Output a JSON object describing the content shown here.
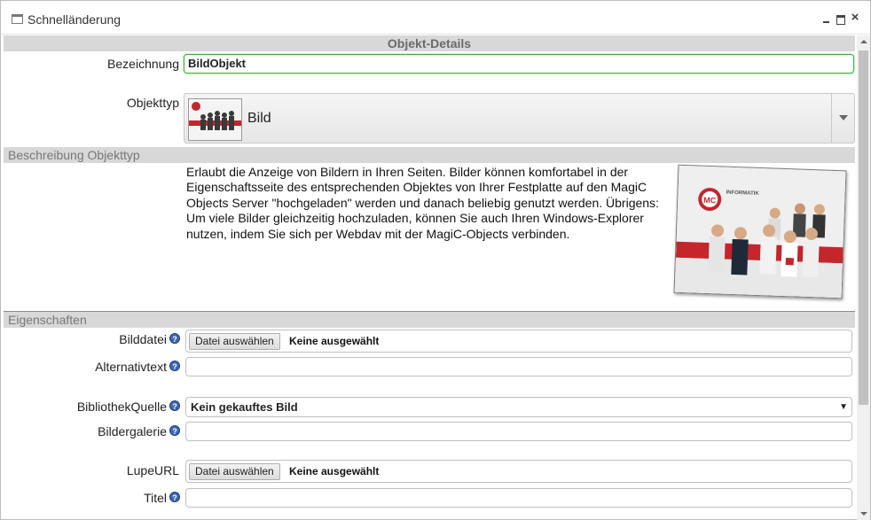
{
  "window": {
    "title": "Schnelländerung"
  },
  "sections": {
    "objekt_details": "Objekt-Details",
    "beschreibung": "Beschreibung Objekttyp",
    "eigenschaften": "Eigenschaften"
  },
  "fields": {
    "bezeichnung": {
      "label": "Bezeichnung",
      "value": "BildObjekt"
    },
    "objekttyp": {
      "label": "Objekttyp",
      "value": "Bild"
    },
    "description": "Erlaubt die Anzeige von Bildern in Ihren Seiten. Bilder können komfortabel in der Eigenschaftsseite des entsprechenden Objektes von Ihrer Festplatte auf den MagiC Objects Server \"hochgeladen\" werden und danach beliebig genutzt werden. Übrigens: Um viele Bilder gleichzeitig hochzuladen, können Sie auch Ihren Windows-Explorer nutzen, indem Sie sich per Webdav mit der MagiC-Objects verbinden.",
    "bilddatei": {
      "label": "Bilddatei",
      "button": "Datei auswählen",
      "status": "Keine ausgewählt"
    },
    "alternativtext": {
      "label": "Alternativtext",
      "value": ""
    },
    "bibliothekquelle": {
      "label": "BibliothekQuelle",
      "value": "Kein gekauftes Bild"
    },
    "bildergalerie": {
      "label": "Bildergalerie",
      "value": ""
    },
    "lupeurl": {
      "label": "LupeURL",
      "button": "Datei auswählen",
      "status": "Keine ausgewählt"
    },
    "titel": {
      "label": "Titel",
      "value": ""
    }
  },
  "photo": {
    "logo_text": "MC",
    "brand": "INFORMATIK"
  },
  "help_glyph": "?",
  "icons": {
    "window": "window-icon",
    "minimize": "minimize-icon",
    "maximize": "maximize-icon",
    "close": "close-icon",
    "help": "help-icon"
  },
  "colors": {
    "section_bg": "#d8d8d8",
    "focus_border": "#38b538",
    "help_blue": "#3e67b3"
  }
}
